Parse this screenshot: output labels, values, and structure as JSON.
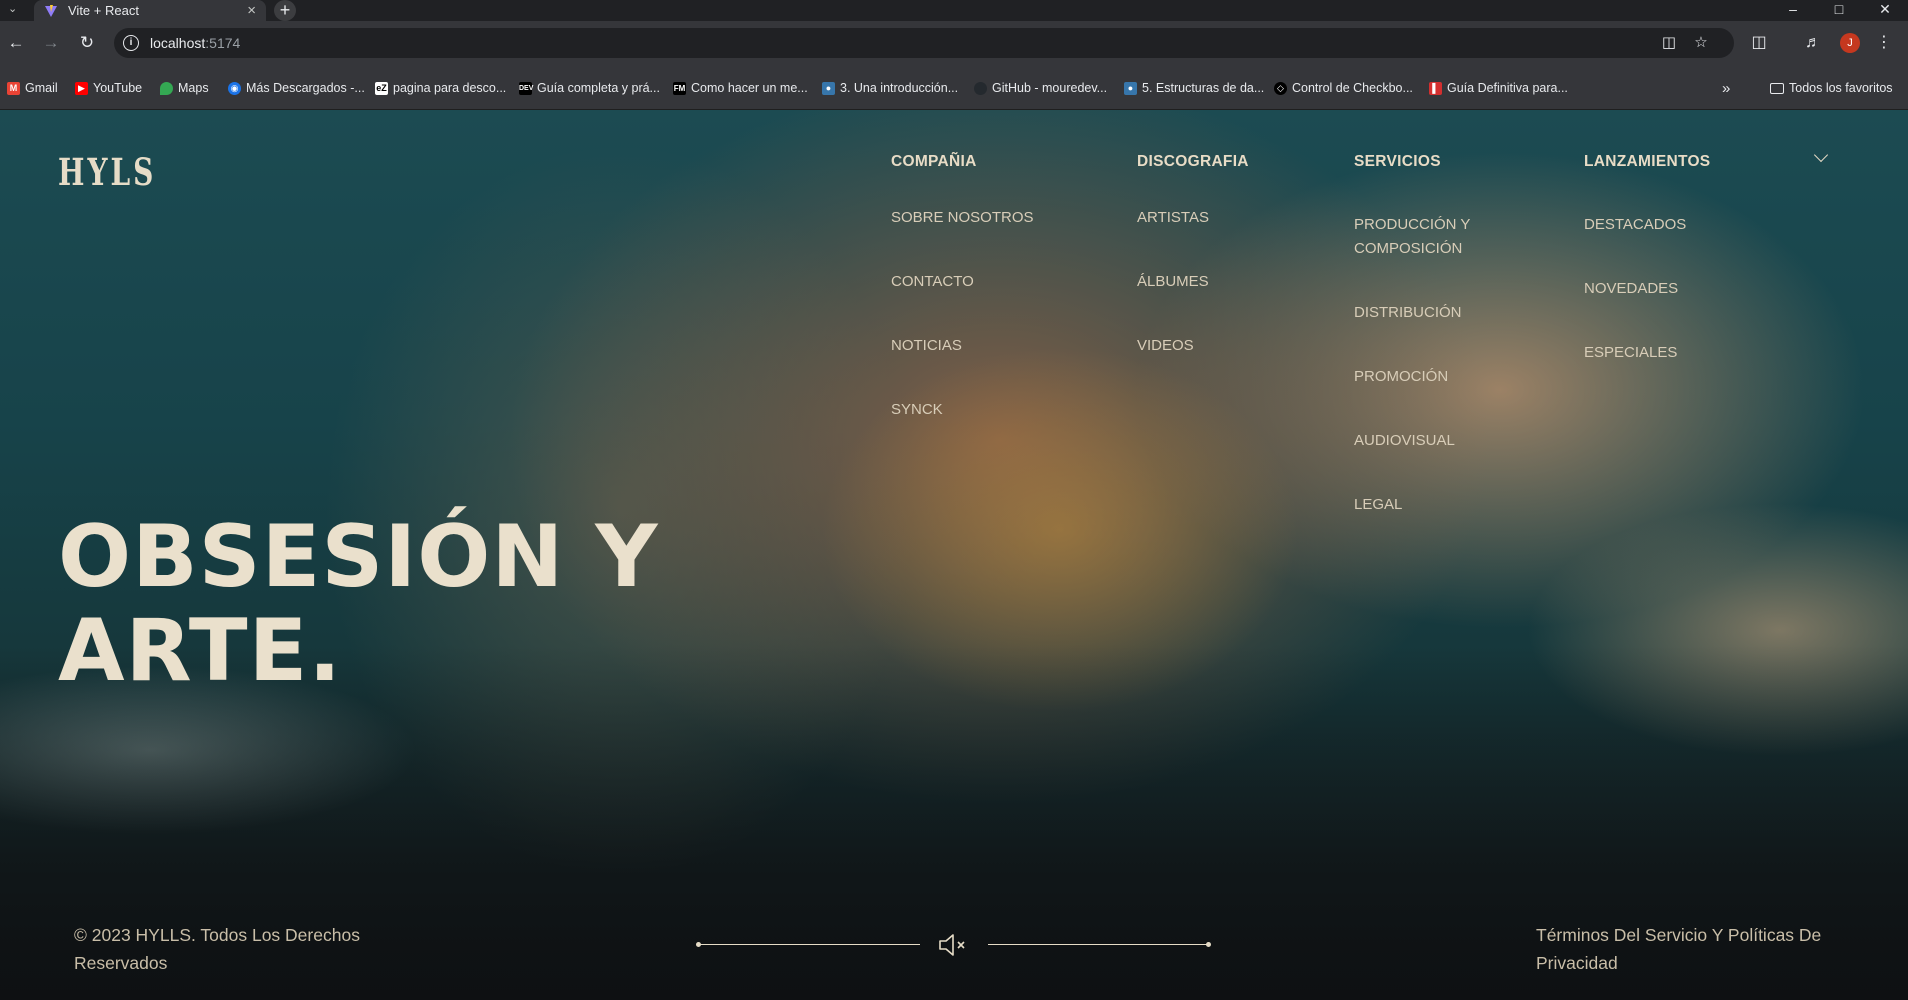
{
  "browser": {
    "tab_title": "Vite + React",
    "url_host": "localhost",
    "url_port": ":5174",
    "avatar_initial": "J",
    "bookmarks": [
      {
        "label": "Gmail",
        "icon": "gmail-icon"
      },
      {
        "label": "YouTube",
        "icon": "youtube-icon"
      },
      {
        "label": "Maps",
        "icon": "maps-icon"
      },
      {
        "label": "Más Descargados -...",
        "icon": "eye-icon"
      },
      {
        "label": "pagina para desco...",
        "icon": "ez-icon"
      },
      {
        "label": "Guía completa y prá...",
        "icon": "dev-icon"
      },
      {
        "label": "Como hacer un me...",
        "icon": "fm-icon"
      },
      {
        "label": "3. Una introducción...",
        "icon": "python-icon"
      },
      {
        "label": "GitHub - mouredev...",
        "icon": "github-icon"
      },
      {
        "label": "5. Estructuras de da...",
        "icon": "python-icon"
      },
      {
        "label": "Control de Checkbo...",
        "icon": "codepen-icon"
      },
      {
        "label": "Guía Definitiva para...",
        "icon": "red-icon"
      }
    ],
    "all_bookmarks_label": "Todos los favoritos"
  },
  "site": {
    "logo": "HYLS",
    "nav": {
      "company": {
        "title": "COMPAÑIA",
        "items": [
          "SOBRE NOSOTROS",
          "CONTACTO",
          "NOTICIAS",
          "SYNCK"
        ]
      },
      "discography": {
        "title": "DISCOGRAFIA",
        "items": [
          "ARTISTAS",
          "ÁLBUMES",
          "VIDEOS"
        ]
      },
      "services": {
        "title": "SERVICIOS",
        "items": [
          "PRODUCCIÓN Y COMPOSICIÓN",
          "DISTRIBUCIÓN",
          "PROMOCIÓN",
          "AUDIOVISUAL",
          "LEGAL"
        ]
      },
      "releases": {
        "title": "LANZAMIENTOS",
        "items": [
          "DESTACADOS",
          "NOVEDADES",
          "ESPECIALES"
        ]
      }
    },
    "hero": {
      "line1": "OBSESIÓN Y",
      "line2": "ARTE."
    },
    "footer": {
      "copyright": "© 2023 HYLLS. Todos Los Derechos Reservados",
      "legal": "Términos Del Servicio Y Políticas De Privacidad"
    },
    "colors": {
      "accent": "#e6dcc7",
      "bg_teal": "#1c4b52"
    }
  }
}
